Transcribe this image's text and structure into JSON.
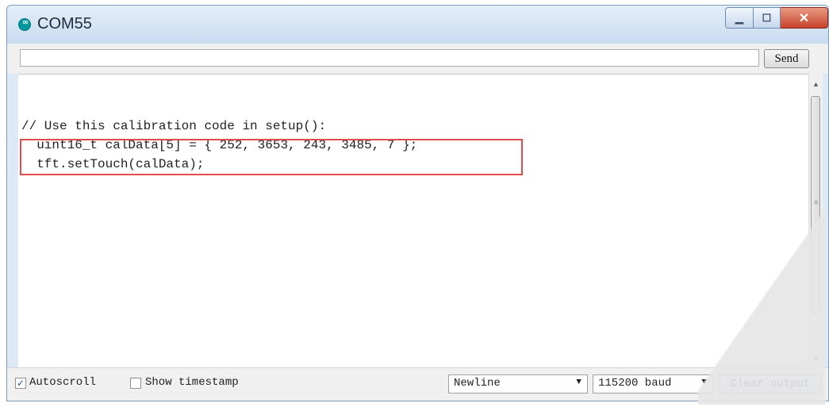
{
  "window": {
    "title": "COM55"
  },
  "input": {
    "value": "",
    "send_label": "Send"
  },
  "output": {
    "lines": [
      "// Use this calibration code in setup():",
      "  uint16_t calData[5] = { 252, 3653, 243, 3485, 7 };",
      "  tft.setTouch(calData);"
    ]
  },
  "footer": {
    "autoscroll_label": "Autoscroll",
    "autoscroll_checked": true,
    "timestamp_label": "Show timestamp",
    "timestamp_checked": false,
    "line_ending": "Newline",
    "baud": "115200 baud",
    "clear_label": "Clear output"
  },
  "colors": {
    "highlight_border": "#e24b4b",
    "close_button": "#c6432a"
  }
}
